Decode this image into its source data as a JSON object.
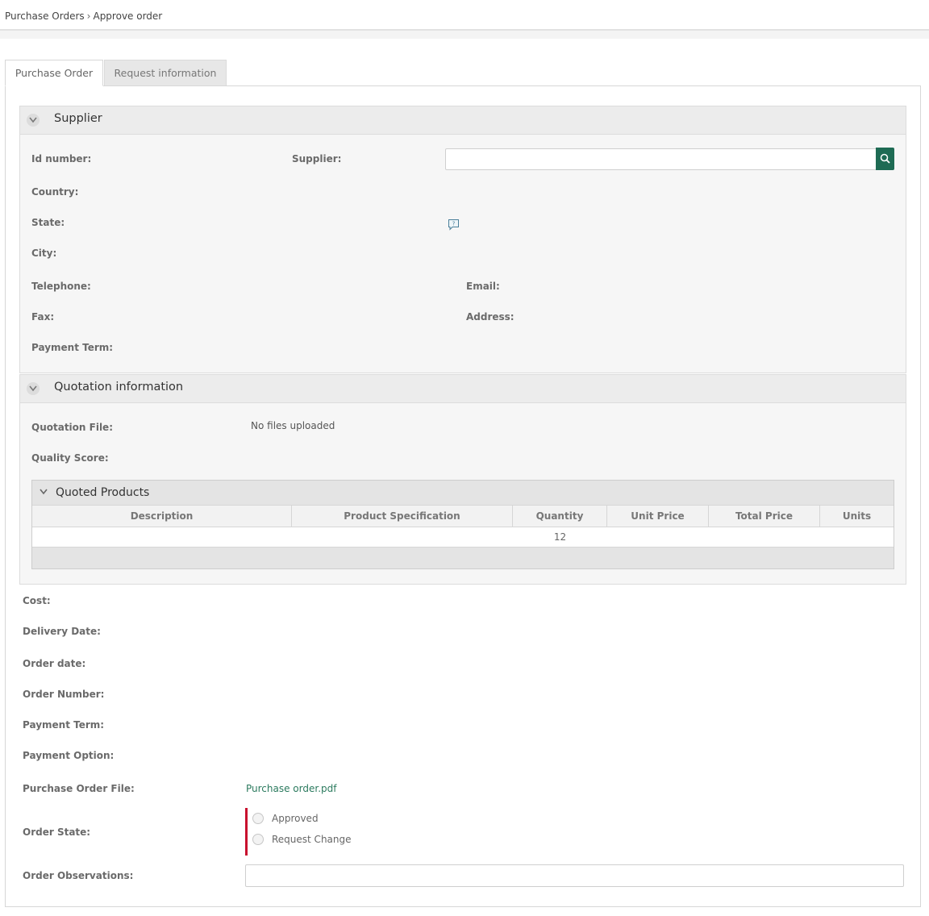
{
  "breadcrumb": {
    "parent": "Purchase Orders",
    "separator": "›",
    "current": "Approve order"
  },
  "tabs": [
    {
      "label": "Purchase Order",
      "active": true
    },
    {
      "label": "Request information",
      "active": false
    }
  ],
  "supplier_section": {
    "title": "Supplier",
    "labels": {
      "id_number": "Id number:",
      "supplier": "Supplier:",
      "country": "Country:",
      "state": "State:",
      "city": "City:",
      "telephone": "Telephone:",
      "email": "Email:",
      "fax": "Fax:",
      "address": "Address:",
      "payment_term": "Payment Term:"
    },
    "supplier_input_value": "",
    "search_icon": "search-icon",
    "help_icon": "help-comment-icon"
  },
  "quotation_section": {
    "title": "Quotation information",
    "labels": {
      "quotation_file": "Quotation File:",
      "quality_score": "Quality Score:"
    },
    "quotation_file_value": "No files uploaded",
    "quoted_products": {
      "title": "Quoted Products",
      "columns": [
        "Description",
        "Product Specification",
        "Quantity",
        "Unit Price",
        "Total Price",
        "Units"
      ],
      "rows": [
        {
          "description": "",
          "specification": "",
          "quantity": "12",
          "unit_price": "",
          "total_price": "",
          "units": ""
        }
      ]
    }
  },
  "order_fields": {
    "cost": "Cost:",
    "delivery_date": "Delivery Date:",
    "order_date": "Order date:",
    "order_number": "Order Number:",
    "payment_term": "Payment Term:",
    "payment_option": "Payment Option:",
    "purchase_order_file": "Purchase Order File:",
    "order_state": "Order State:",
    "order_observations": "Order Observations:"
  },
  "purchase_order_file_link": "Purchase order.pdf",
  "order_state_options": [
    "Approved",
    "Request Change"
  ],
  "order_observations_value": "",
  "colors": {
    "accent": "#1e6b54",
    "link": "#2b7a5e",
    "required": "#c8102e"
  }
}
